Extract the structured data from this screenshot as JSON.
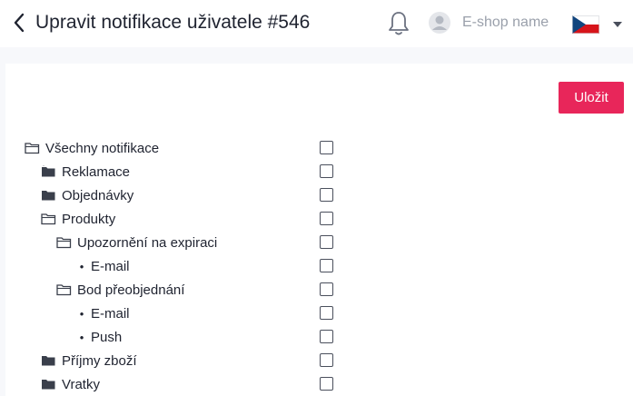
{
  "header": {
    "title": "Upravit notifikace uživatele #546",
    "shop_name": "E-shop name"
  },
  "actions": {
    "save_label": "Uložit"
  },
  "tree": [
    {
      "label": "Všechny notifikace",
      "icon": "folder-open-icon",
      "level": 0,
      "checked": false
    },
    {
      "label": "Reklamace",
      "icon": "folder-filled-icon",
      "level": 1,
      "checked": false
    },
    {
      "label": "Objednávky",
      "icon": "folder-filled-icon",
      "level": 1,
      "checked": false
    },
    {
      "label": "Produkty",
      "icon": "folder-open-icon",
      "level": 1,
      "checked": false
    },
    {
      "label": "Upozornění na expiraci",
      "icon": "folder-open-icon",
      "level": 2,
      "checked": false
    },
    {
      "label": "E-mail",
      "icon": "bullet",
      "level": 3,
      "checked": false
    },
    {
      "label": "Bod přeobjednání",
      "icon": "folder-open-icon",
      "level": 2,
      "checked": false
    },
    {
      "label": "E-mail",
      "icon": "bullet",
      "level": 3,
      "checked": false
    },
    {
      "label": "Push",
      "icon": "bullet",
      "level": 3,
      "checked": false
    },
    {
      "label": "Příjmy zboží",
      "icon": "folder-filled-icon",
      "level": 1,
      "checked": false
    },
    {
      "label": "Vratky",
      "icon": "folder-filled-icon",
      "level": 1,
      "checked": false
    }
  ],
  "colors": {
    "accent": "#e8265a",
    "muted": "#9aa0ab"
  }
}
